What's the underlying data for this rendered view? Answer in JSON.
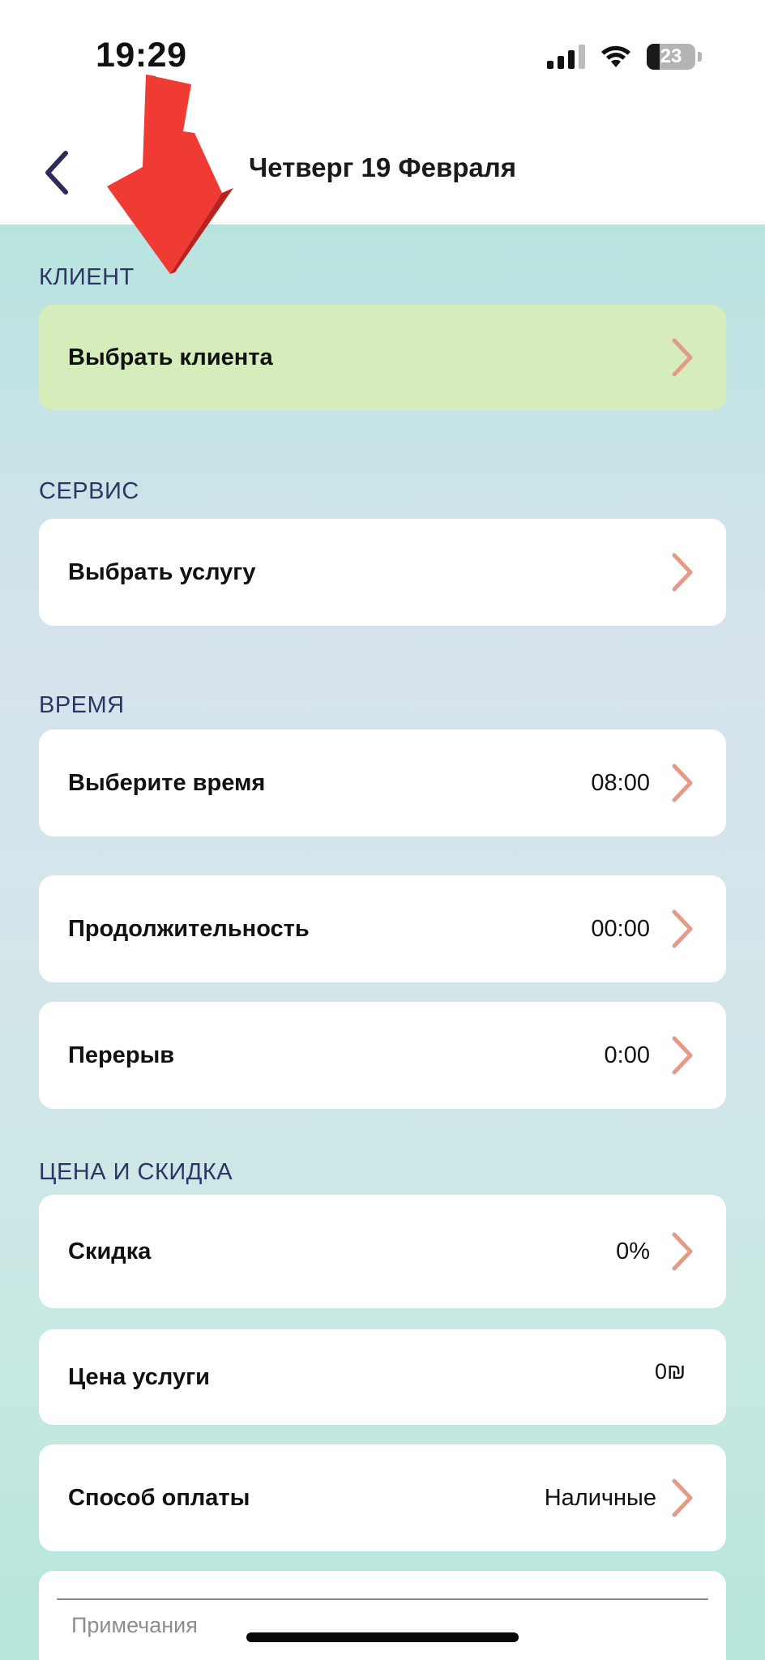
{
  "status_bar": {
    "time": "19:29",
    "battery": "23"
  },
  "nav": {
    "title": "Четверг 19 Февраля"
  },
  "sections": {
    "client": {
      "label": "КЛИЕНТ",
      "select_client": "Выбрать клиента"
    },
    "service": {
      "label": "СЕРВИС",
      "select_service": "Выбрать услугу"
    },
    "time": {
      "label": "ВРЕМЯ",
      "select_time": "Выберите время",
      "select_time_value": "08:00",
      "duration": "Продолжительность",
      "duration_value": "00:00",
      "break": "Перерыв",
      "break_value": "0:00"
    },
    "price": {
      "label": "ЦЕНА И СКИДКА",
      "discount": "Скидка",
      "discount_value": "0%",
      "service_price": "Цена услуги",
      "service_price_value": "0₪",
      "payment_method": "Способ оплаты",
      "payment_method_value": "Наличные"
    },
    "notes": {
      "placeholder": "Примечания"
    }
  },
  "colors": {
    "accent_chevron": "#e59a87",
    "section_label": "#2d3565",
    "highlight_card": "#d6edbb",
    "annotation_arrow": "#f03a34"
  },
  "icons": [
    "signal-icon",
    "wifi-icon",
    "battery-icon",
    "back-chevron-icon",
    "chevron-right-icon",
    "annotation-arrow-icon"
  ]
}
